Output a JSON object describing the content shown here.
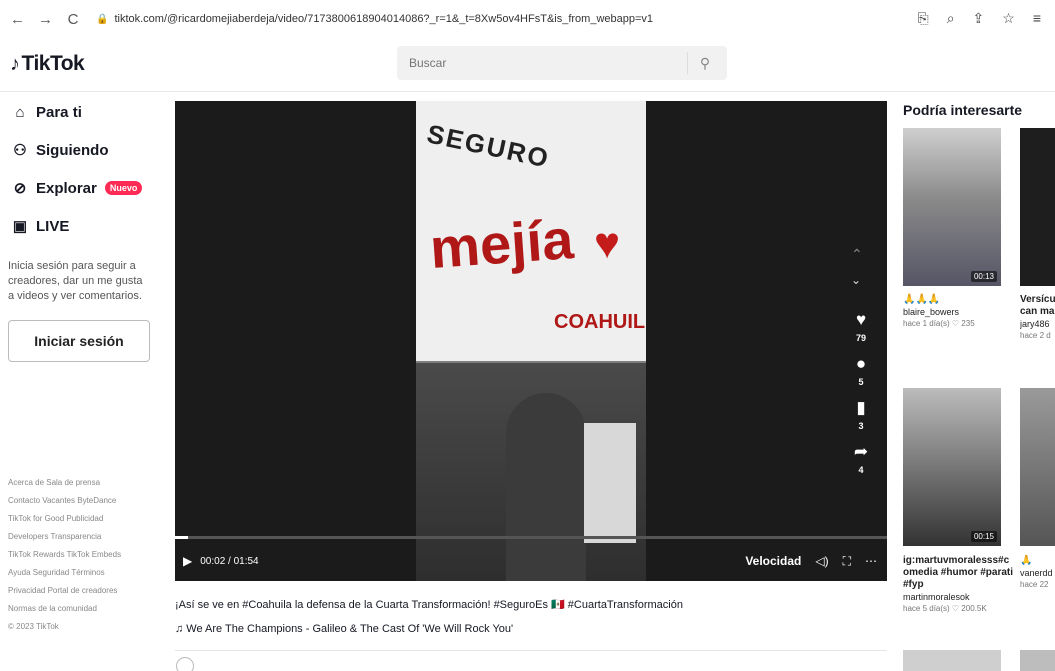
{
  "browser": {
    "url": "tiktok.com/@ricardomejiaberdeja/video/7173800618904014086?_r=1&_t=8Xw5ov4HFsT&is_from_webapp=v1"
  },
  "header": {
    "logo": "TikTok",
    "search_placeholder": "Buscar"
  },
  "sidebar": {
    "items": [
      {
        "label": "Para ti",
        "icon": "home-icon"
      },
      {
        "label": "Siguiendo",
        "icon": "following-icon"
      },
      {
        "label": "Explorar",
        "icon": "compass-icon",
        "badge": "Nuevo"
      },
      {
        "label": "LIVE",
        "icon": "live-icon"
      }
    ],
    "login_prompt": "Inicia sesión para seguir a creadores, dar un me gusta a videos y ver comentarios.",
    "login_button": "Iniciar sesión",
    "footer": [
      "Acerca de  Sala de prensa",
      "Contacto  Vacantes  ByteDance",
      "TikTok for Good  Publicidad",
      "Developers  Transparencia",
      "TikTok Rewards  TikTok Embeds",
      "Ayuda  Seguridad  Términos",
      "Privacidad  Portal de creadores",
      "Normas de la comunidad",
      "© 2023 TikTok"
    ]
  },
  "video": {
    "poster_top": "SEGURO",
    "poster_name": "mejía",
    "poster_state": "COAHUIL",
    "likes": "79",
    "comments": "5",
    "saves": "3",
    "shares": "4",
    "time": "00:02 / 01:54",
    "progress": 0.018,
    "speed_label": "Velocidad",
    "caption": "¡Así se ve en #Coahuila la defensa de la Cuarta Transformación! #SeguroEs 🇲🇽 #CuartaTransformación",
    "music": "♫ We Are The Champions - Galileo & The Cast Of 'We Will Rock You'"
  },
  "recommended": {
    "title": "Podría interesarte",
    "items": [
      {
        "duration": "00:13",
        "title": "🙏🙏🙏",
        "author": "blaire_bowers",
        "meta": "hace 1 día(s)  ♡ 235"
      },
      {
        "duration": "",
        "title": "Versícu que can manera",
        "author": "jary486",
        "meta": "hace 2 d"
      },
      {
        "duration": "00:15",
        "title": "ig:martuvmoralesss#c omedia #humor #parati #fyp",
        "author": "martinmoralesok",
        "meta": "hace 5 día(s)  ♡ 200.5K"
      },
      {
        "duration": "",
        "title": "🙏",
        "author": "vanerdd",
        "meta": "hace 22"
      }
    ]
  }
}
